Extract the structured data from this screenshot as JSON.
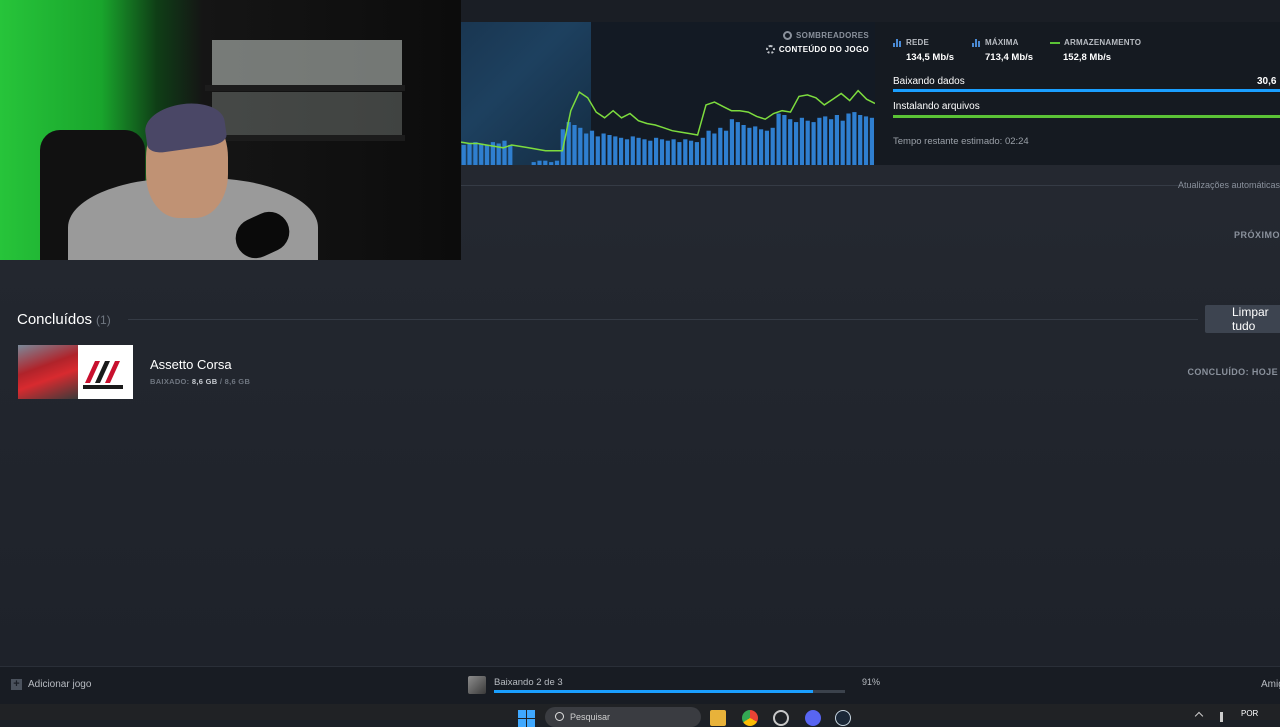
{
  "download_panel": {
    "stages": [
      "SOMBREADORES",
      "CONTEÚDO DO JOGO"
    ],
    "stats": [
      {
        "label": "REDE",
        "value": "134,5 Mb/s",
        "icon": "bars-icon"
      },
      {
        "label": "MÁXIMA",
        "value": "713,4 Mb/s",
        "icon": "bars-icon"
      },
      {
        "label": "ARMAZENAMENTO",
        "value": "152,8 Mb/s",
        "icon": "line-icon"
      }
    ],
    "progress": [
      {
        "label": "Baixando dados",
        "value": "30,6",
        "color": "#1a9fff"
      },
      {
        "label": "Instalando arquivos",
        "value": "",
        "color": "#5bc336"
      }
    ],
    "remaining": "Tempo restante estimado: 02:24",
    "graph": {
      "bar_color": "#2f7fd0",
      "line_color": "#7ddc3e",
      "network_bars": [
        0.14,
        0.15,
        0.16,
        0.15,
        0.14,
        0.16,
        0.15,
        0.17,
        0.14,
        0.0,
        0.0,
        0.0,
        0.02,
        0.03,
        0.03,
        0.02,
        0.03,
        0.25,
        0.3,
        0.28,
        0.26,
        0.22,
        0.24,
        0.2,
        0.22,
        0.21,
        0.2,
        0.19,
        0.18,
        0.2,
        0.19,
        0.18,
        0.17,
        0.19,
        0.18,
        0.17,
        0.18,
        0.16,
        0.18,
        0.17,
        0.16,
        0.19,
        0.24,
        0.22,
        0.26,
        0.24,
        0.32,
        0.3,
        0.28,
        0.26,
        0.27,
        0.25,
        0.24,
        0.26,
        0.36,
        0.35,
        0.32,
        0.3,
        0.33,
        0.31,
        0.3,
        0.33,
        0.34,
        0.32,
        0.35,
        0.31,
        0.36,
        0.37,
        0.35,
        0.34,
        0.33
      ],
      "storage_line": [
        0.16,
        0.15,
        0.15,
        0.14,
        0.13,
        0.12,
        0.14,
        0.13,
        0.12,
        0.11,
        0.1,
        0.1,
        0.1,
        0.38,
        0.51,
        0.47,
        0.37,
        0.33,
        0.38,
        0.33,
        0.36,
        0.31,
        0.29,
        0.28,
        0.26,
        0.24,
        0.23,
        0.22,
        0.21,
        0.42,
        0.44,
        0.41,
        0.38,
        0.38,
        0.37,
        0.34,
        0.32,
        0.36,
        0.38,
        0.37,
        0.48,
        0.49,
        0.47,
        0.42,
        0.46,
        0.5,
        0.45,
        0.52,
        0.46,
        0.43
      ]
    }
  },
  "auto_updates": "Atualizações automáticas",
  "next_label": "PRÓXIMO",
  "completed": {
    "title": "Concluídos",
    "count": "(1)",
    "clear_button": "Limpar tudo",
    "items": [
      {
        "name": "Assetto Corsa",
        "downloaded_label": "BAIXADO:",
        "downloaded": "8,6 GB",
        "total": "/ 8,6 GB",
        "status": "CONCLUÍDO: HOJE"
      }
    ]
  },
  "bottom_bar": {
    "add_game": "Adicionar jogo",
    "download_status": "Baixando 2 de 3",
    "download_percent": "91%",
    "download_progress": 0.91,
    "friends": "Amigos"
  },
  "taskbar": {
    "search_placeholder": "Pesquisar",
    "language": "POR",
    "icons": [
      "windows-start-icon",
      "search-icon",
      "file-explorer-icon",
      "chrome-icon",
      "app-icon",
      "discord-icon",
      "steam-icon"
    ]
  }
}
